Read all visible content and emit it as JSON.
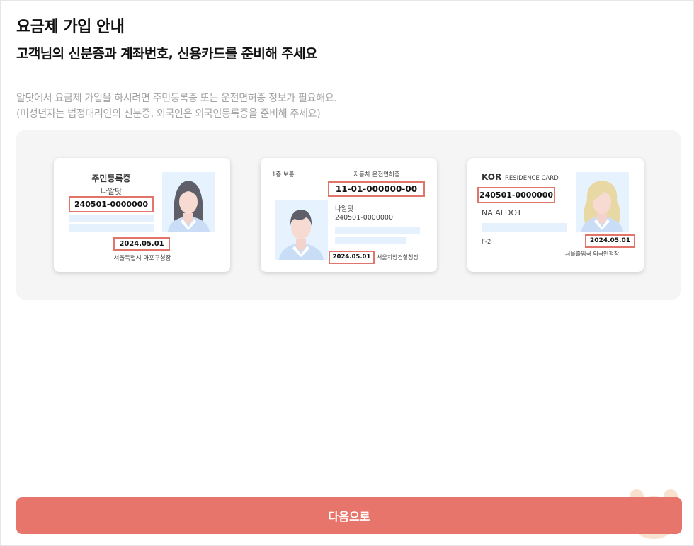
{
  "header": {
    "title": "요금제 가입 안내",
    "subtitle": "고객님의 신분증과 계좌번호, 신용카드를 준비해 주세요"
  },
  "description": {
    "line1": "알닷에서 요금제 가입을 하시려면 주민등록증 또는 운전면허증 정보가 필요해요.",
    "line2": "(미성년자는 법정대리인의 신분증, 외국인은 외국인등록증을 준비해 주세요)"
  },
  "cards": {
    "resident": {
      "title": "주민등록증",
      "name": "나알닷",
      "id_number": "240501-0000000",
      "issue_date": "2024.05.01",
      "issuer": "서울특별시 마포구청장"
    },
    "license": {
      "license_class": "1종 보통",
      "title": "자동차 운전면허증",
      "license_number": "11-01-000000-00",
      "name": "나알닷",
      "id_number": "240501-0000000",
      "issue_date": "2024.05.01",
      "issuer": "서울지방경찰청장"
    },
    "residence": {
      "country": "KOR",
      "title": "RESIDENCE CARD",
      "id_number": "240501-0000000",
      "name": "NA ALDOT",
      "visa": "F-2",
      "issue_date": "2024.05.01",
      "issuer": "서울출입국 외국인청장"
    }
  },
  "footer": {
    "next_label": "다음으로"
  },
  "colors": {
    "accent": "#e8756c",
    "highlight_border": "#e2756b",
    "panel_bg": "#f5f5f5",
    "bar_fill": "#e5f2fd"
  }
}
